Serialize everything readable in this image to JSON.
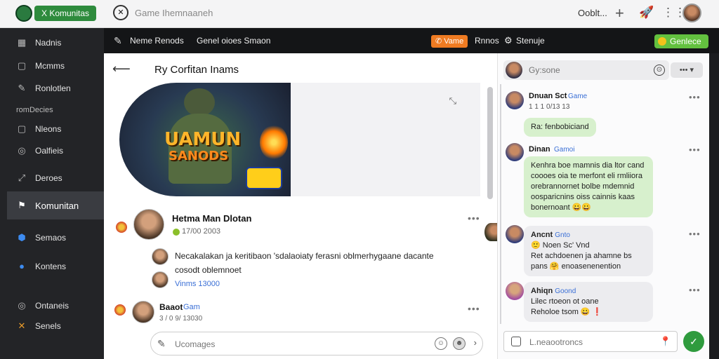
{
  "topbar": {
    "pill_label": "X Komunitas",
    "game_icon": "✕",
    "title": "Game Ihemnaaneh",
    "account_label": "Ooblt...",
    "plus_icon": "+",
    "rocket_icon": "🚀",
    "grid_icon": "⋮⋮"
  },
  "sidebar": {
    "items": [
      {
        "label": "Nadnis",
        "icon": "▦"
      },
      {
        "label": "Mcmms",
        "icon": "▢"
      },
      {
        "label": "Ronlotlen",
        "icon": "✎"
      },
      {
        "label": "Nleons",
        "icon": "▢"
      },
      {
        "label": "Oalfieis",
        "icon": "◎"
      },
      {
        "label": "Deroes",
        "icon": "⤢"
      },
      {
        "label": "Komunitan",
        "icon": "⚑"
      },
      {
        "label": "Semaos",
        "icon": "⬢"
      },
      {
        "label": "Kontens",
        "icon": "●"
      },
      {
        "label": "Ontaneis",
        "icon": "◎"
      },
      {
        "label": "Senels",
        "icon": "✕"
      }
    ],
    "section_label": "romDecies"
  },
  "header": {
    "crumb1": "Neme Renods",
    "crumb2": "Genel oioes Smaon",
    "orange_badge": "✆ Vame",
    "button1": "Rnnos",
    "button2_icon": "⚙",
    "button2": "Stenuje",
    "green_button": "Genlece"
  },
  "main": {
    "back_icon": "⟵",
    "title": "Ry Corfitan Inams",
    "banner_line1": "UAMUN",
    "banner_line2": "SANODS",
    "expand_icon": "⤡",
    "post": {
      "author": "Hetma Man Dlotan",
      "date": "17/00 2003",
      "text_line1": "Necakalakan ja keritibaon 'sdalaoiaty ferasni oblmerhygaane dacante",
      "text_line2": "cosodt oblemnoet",
      "link": "Vinms 13000",
      "more": "•••"
    },
    "comment2": {
      "name": "Baaot",
      "tag": "Gam",
      "date": "3 / 0 9/ 13030",
      "more": "•••"
    },
    "input": {
      "pen_icon": "✎",
      "placeholder": "Ucomages",
      "emoji1": "☺",
      "emoji2": "☻",
      "more": "›"
    }
  },
  "chat": {
    "search_placeholder": "Gy:sone",
    "search_icon": "⊙",
    "menu_label": "••• ▾",
    "messages": [
      {
        "name": "Dnuan Sct",
        "tag": "Game",
        "sub": "1 1 1 0/13 13",
        "bubble": "Ra: fenbobiciand",
        "more": "•••"
      },
      {
        "name": "Dinan",
        "tag": "Gamoi",
        "bubble_lines": [
          "Kenhra boe mamnis dia ltor cand",
          "coooes oia te merfont eli rmliiora",
          "orebrannornet bolbe mdemnid",
          "oosparicnins oiss cainnis kaas",
          "bonernoant 😀😀"
        ],
        "more": "•••"
      },
      {
        "name": "Ancnt",
        "tag": "Gnto",
        "line1": "🙂 Noen Sc' Vnd",
        "line2": "Ret achdoenen ja ahamne  bs",
        "line3": "pans 🤗 enoasenenention",
        "more": "•••"
      },
      {
        "name": "Ahiqn",
        "tag": "Goond",
        "line1": "Lilec rtoeon ot oane",
        "line2": "Reholoe tsom 😀 ❗",
        "more": "•••"
      }
    ],
    "input_placeholder": "L.neaootroncs",
    "pin_icon": "📍",
    "send_icon": "✓"
  }
}
